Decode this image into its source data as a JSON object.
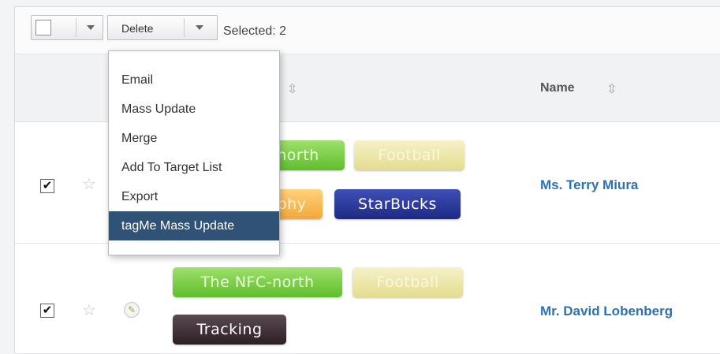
{
  "toolbar": {
    "delete_label": "Delete",
    "selected_text": "Selected: 2"
  },
  "header": {
    "name_column": "Name",
    "sort_glyph": "⇳"
  },
  "menu": {
    "items": [
      "Email",
      "Mass Update",
      "Merge",
      "Add To Target List",
      "Export",
      "tagMe Mass Update"
    ],
    "active_index": 5
  },
  "rows": [
    {
      "checked": true,
      "tags": [
        "north",
        "Football",
        "ophy",
        "StarBucks"
      ],
      "name": "Ms. Terry Miura"
    },
    {
      "checked": true,
      "tags": [
        "The NFC-north",
        "Football",
        "Tracking"
      ],
      "name": "Mr. David Lobenberg"
    }
  ],
  "icons": {
    "check": "✔",
    "star": "☆",
    "pencil": "✎"
  },
  "colors": {
    "link": "#2a72b5",
    "menu_active": "#2f5276"
  }
}
